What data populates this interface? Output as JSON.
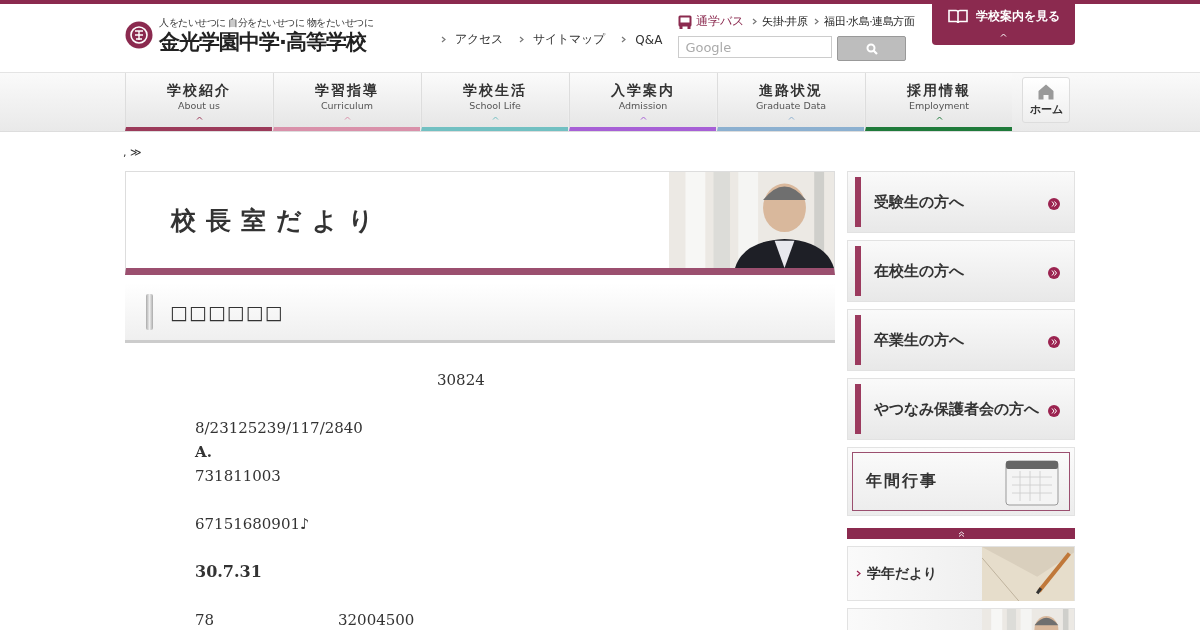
{
  "header": {
    "tagline": "人をたいせつに 自分をたいせつに 物をたいせつに",
    "school_name": "金光学園中学·高等学校",
    "links": [
      "アクセス",
      "サイトマップ",
      "Q&A"
    ],
    "bus": {
      "label": "通学バス",
      "routes": [
        "矢掛·井原",
        "福田·水島·連島方面"
      ]
    },
    "search": {
      "placeholder": "Google"
    },
    "brochure_button": "学校案内を見る"
  },
  "nav": {
    "items": [
      {
        "label": "学校紹介",
        "sublabel": "About us",
        "color": "#9b3a5a"
      },
      {
        "label": "学習指導",
        "sublabel": "Curriculum",
        "color": "#d991aa"
      },
      {
        "label": "学校生活",
        "sublabel": "School Life",
        "color": "#72c0c2"
      },
      {
        "label": "入学案内",
        "sublabel": "Admission",
        "color": "#a760d6"
      },
      {
        "label": "進路状況",
        "sublabel": "Graduate Data",
        "color": "#8cb0d0"
      },
      {
        "label": "採用情報",
        "sublabel": "Employment",
        "color": "#1f7a3a"
      }
    ],
    "home": "ホーム"
  },
  "breadcrumb": ", ≫",
  "banner": {
    "title": "校長室だより"
  },
  "section_heading": "□□□□□□",
  "article": {
    "blocks": [
      [
        {
          "kind": "center",
          "text": "30824"
        }
      ],
      [
        {
          "kind": "plain",
          "text": "8/23125239/117/2840"
        },
        {
          "kind": "bold",
          "text": "A."
        },
        {
          "kind": "plain",
          "text": "731811003"
        }
      ],
      [
        {
          "kind": "plain",
          "text": "67151680901♪"
        }
      ],
      [
        {
          "kind": "heading",
          "text": "30.7.31"
        }
      ],
      [
        {
          "kind": "pair",
          "text": "78",
          "text2": "32004500"
        }
      ]
    ]
  },
  "sidebar": {
    "links": [
      "受験生の方へ",
      "在校生の方へ",
      "卒業生の方へ",
      "やつなみ保護者会の方へ"
    ],
    "calendar": "年間行事",
    "features": [
      {
        "kind": "link",
        "label": "学年だより"
      },
      {
        "kind": "picture"
      }
    ]
  }
}
